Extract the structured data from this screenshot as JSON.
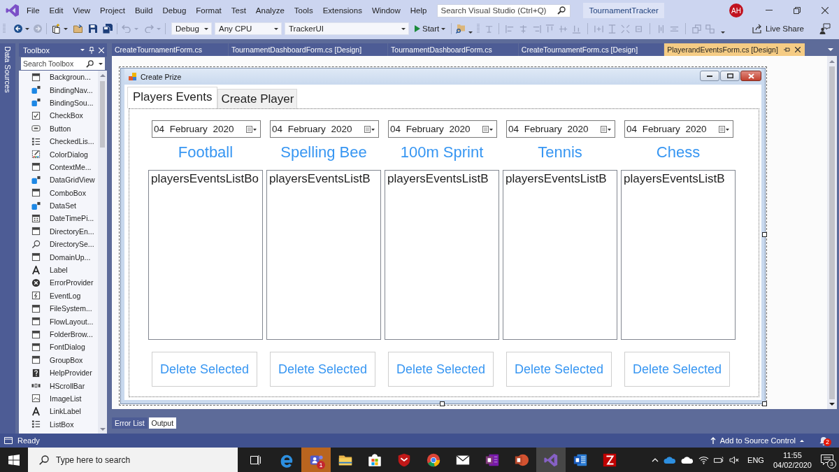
{
  "menu_bar": {
    "menus": [
      "File",
      "Edit",
      "View",
      "Project",
      "Build",
      "Debug",
      "Format",
      "Test",
      "Analyze",
      "Tools",
      "Extensions",
      "Window",
      "Help"
    ],
    "search": {
      "placeholder": "Search Visual Studio (Ctrl+Q)"
    },
    "solution_name": "TournamentTracker",
    "avatar": "AH"
  },
  "toolbar": {
    "dropdowns": [
      "Debug",
      "Any CPU",
      "TrackerUI"
    ],
    "start_button": "Start",
    "live_share": "Live Share"
  },
  "side_tab": "Data Sources",
  "toolbox": {
    "title": "Toolbox",
    "search": {
      "placeholder": "Search Toolbox"
    },
    "items": [
      "Backgroun...",
      "BindingNav...",
      "BindingSou...",
      "CheckBox",
      "Button",
      "CheckedLis...",
      "ColorDialog",
      "ContextMe...",
      "DataGridView",
      "ComboBox",
      "DataSet",
      "DateTimePi...",
      "DirectoryEn...",
      "DirectorySe...",
      "DomainUp...",
      "Label",
      "ErrorProvider",
      "EventLog",
      "FileSystem...",
      "FlowLayout...",
      "FolderBrow...",
      "FontDialog",
      "GroupBox",
      "HelpProvider",
      "HScrollBar",
      "ImageList",
      "LinkLabel",
      "ListBox"
    ]
  },
  "document_tabs": [
    {
      "label": "CreateTournamentForm.cs",
      "selected": false
    },
    {
      "label": "TournamentDashboardForm.cs [Design]",
      "selected": false
    },
    {
      "label": "TournamentDashboardForm.cs",
      "selected": false
    },
    {
      "label": "CreateTournamentForm.cs [Design]",
      "selected": false
    },
    {
      "label": "PlayerandEventsForm.cs [Design]",
      "selected": true
    }
  ],
  "designer": {
    "form": {
      "title": "Create Prize",
      "tabs": [
        {
          "label": "Players Events",
          "selected": true
        },
        {
          "label": "Create Player",
          "selected": false
        }
      ],
      "columns": [
        {
          "date": "04 February 2020",
          "event": "Football",
          "list_item": "playersEventsListBo",
          "button": "Delete Selected"
        },
        {
          "date": "04 February 2020",
          "event": "Spelling Bee",
          "list_item": "playersEventsListB",
          "button": "Delete Selected"
        },
        {
          "date": "04 February 2020",
          "event": "100m Sprint",
          "list_item": "playersEventsListB",
          "button": "Delete Selected"
        },
        {
          "date": "04 February 2020",
          "event": "Tennis",
          "list_item": "playersEventsListB",
          "button": "Delete Selected"
        },
        {
          "date": "04 February 2020",
          "event": "Chess",
          "list_item": "playersEventsListB",
          "button": "Delete Selected"
        }
      ]
    }
  },
  "output_tabs": [
    {
      "label": "Error List",
      "selected": false
    },
    {
      "label": "Output",
      "selected": true
    }
  ],
  "status_bar": {
    "status": "Ready",
    "source_control": "Add to Source Control",
    "notification_count": "2"
  },
  "taskbar": {
    "search": {
      "placeholder": "Type here to search"
    },
    "apps": [
      {
        "active": false,
        "flashing": false
      },
      {
        "active": false,
        "flashing": true,
        "badge": "1"
      },
      {
        "active": false,
        "flashing": false
      },
      {
        "active": false,
        "flashing": false
      },
      {
        "active": false,
        "flashing": false
      },
      {
        "active": false,
        "flashing": false
      },
      {
        "active": false,
        "flashing": false
      },
      {
        "active": false,
        "flashing": false
      },
      {
        "active": false,
        "flashing": false
      },
      {
        "active": true,
        "flashing": false
      },
      {
        "active": false,
        "flashing": false
      },
      {
        "active": false,
        "flashing": false
      }
    ],
    "language": "ENG",
    "time": "11:55",
    "date": "04/02/2020",
    "notification_count": "3"
  }
}
